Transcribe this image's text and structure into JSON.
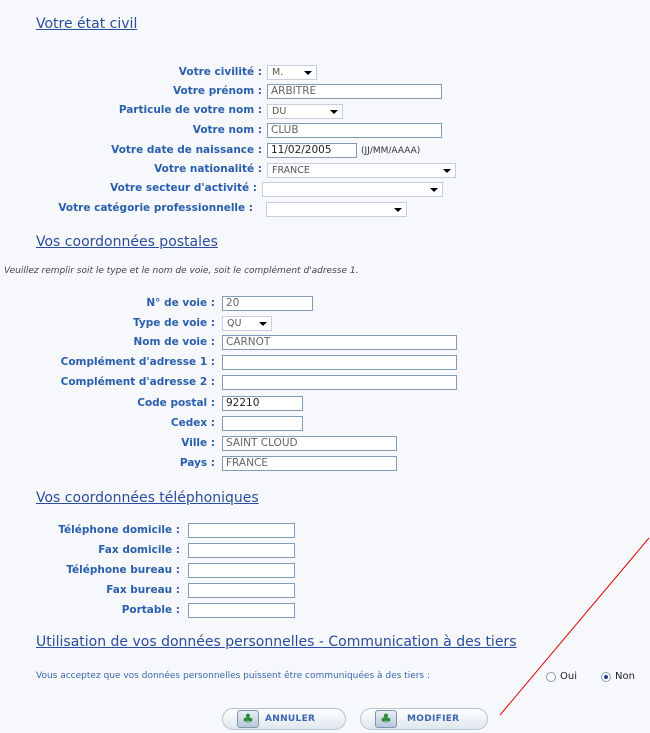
{
  "etat_civil": {
    "title": "Votre état civil",
    "civilite": {
      "label": "Votre civilité :",
      "value": "M."
    },
    "prenom": {
      "label": "Votre prénom :",
      "value": "ARBITRE"
    },
    "particule": {
      "label": "Particule de votre nom :",
      "value": "DU"
    },
    "nom": {
      "label": "Votre nom :",
      "value": "CLUB"
    },
    "naissance": {
      "label": "Votre date de naissance :",
      "value": "11/02/2005",
      "hint": "(JJ/MM/AAAA)"
    },
    "nationalite": {
      "label": "Votre nationalité :",
      "value": "FRANCE"
    },
    "secteur": {
      "label": "Votre secteur d'activité :",
      "value": ""
    },
    "categorie": {
      "label": "Votre catégorie professionnelle :",
      "value": ""
    }
  },
  "postales": {
    "title": "Vos coordonnées postales",
    "note": "Veuillez remplir soit le type et le nom de voie, soit le complément d'adresse 1.",
    "num_voie": {
      "label": "N° de voie :",
      "value": "20"
    },
    "type_voie": {
      "label": "Type de voie :",
      "value": "QU"
    },
    "nom_voie": {
      "label": "Nom de voie :",
      "value": "CARNOT"
    },
    "complement1": {
      "label": "Complément d'adresse 1 :",
      "value": ""
    },
    "complement2": {
      "label": "Complément d'adresse 2 :",
      "value": ""
    },
    "code_postal": {
      "label": "Code postal :",
      "value": "92210"
    },
    "cedex": {
      "label": "Cedex :",
      "value": ""
    },
    "ville": {
      "label": "Ville :",
      "value": "SAINT CLOUD"
    },
    "pays": {
      "label": "Pays :",
      "value": "FRANCE"
    }
  },
  "telephoniques": {
    "title": "Vos coordonnées téléphoniques",
    "tel_domicile": {
      "label": "Téléphone domicile :",
      "value": ""
    },
    "fax_domicile": {
      "label": "Fax domicile :",
      "value": ""
    },
    "tel_bureau": {
      "label": "Téléphone bureau :",
      "value": ""
    },
    "fax_bureau": {
      "label": "Fax bureau :",
      "value": ""
    },
    "portable": {
      "label": "Portable :",
      "value": ""
    }
  },
  "donnees": {
    "title": "Utilisation de vos données personnelles - Communication à des tiers",
    "question": "Vous acceptez que vos données personnelles puissent être communiquées à des tiers :",
    "oui_label": "Oui",
    "non_label": "Non",
    "selected": "Non"
  },
  "buttons": {
    "annuler": "ANNULER",
    "modifier": "MODIFIER"
  },
  "colors": {
    "label": "#2a5fad",
    "section": "#2a4d9c",
    "annotation": "#e00000"
  },
  "icons": {
    "button_icon": "club-card-icon"
  }
}
